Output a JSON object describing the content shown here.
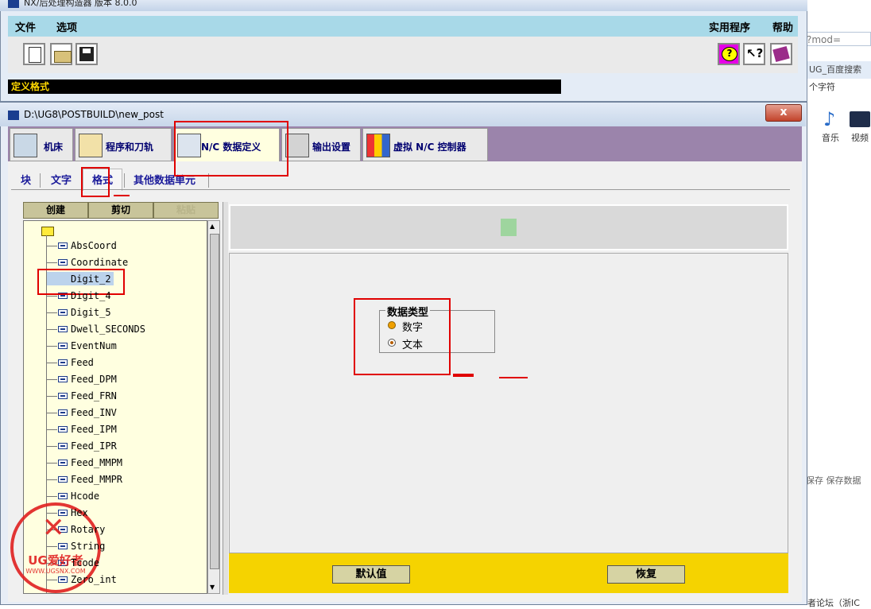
{
  "window1": {
    "title": "NX/后处理构造器 版本 8.0.0",
    "menu": {
      "file": "文件",
      "options": "选项",
      "utilities": "实用程序",
      "help": "帮助"
    },
    "status_text": "定义格式"
  },
  "window2": {
    "title": "D:\\UG8\\POSTBUILD\\new_post",
    "close_label": "x",
    "main_tabs": [
      "机床",
      "程序和刀轨",
      "N/C 数据定义",
      "输出设置",
      "虚拟 N/C 控制器"
    ],
    "sub_tabs": [
      "块",
      "文字",
      "格式",
      "其他数据单元"
    ],
    "tree_buttons": {
      "create": "创建",
      "cut": "剪切",
      "paste": "粘贴"
    },
    "tree_items": [
      "AbsCoord",
      "Coordinate",
      "Digit_2",
      "Digit_4",
      "Digit_5",
      "Dwell_SECONDS",
      "EventNum",
      "Feed",
      "Feed_DPM",
      "Feed_FRN",
      "Feed_INV",
      "Feed_IPM",
      "Feed_IPR",
      "Feed_MMPM",
      "Feed_MMPR",
      "Hcode",
      "Hex",
      "Rotary",
      "String",
      "Tcode",
      "Zero_int"
    ],
    "selected_item": "Digit_2",
    "data_type": {
      "title": "数据类型",
      "options": [
        "数字",
        "文本"
      ],
      "selected": "文本"
    },
    "buttons": {
      "default": "默认值",
      "restore": "恢复"
    }
  },
  "browser_bg": {
    "url_fragment": "?mod=",
    "tab": "UG_百度搜索",
    "text1": "个字符",
    "icons": [
      "音乐",
      "视频"
    ],
    "save_text": "保存 保存数据",
    "footer_text": "者论坛（浙IC"
  },
  "watermark": {
    "brand": "UG爱好者",
    "url": "WWW.UGSNX.COM"
  },
  "colors": {
    "menubar": "#a8d9e8",
    "tab_strip": "#9b84ab",
    "tree_bg": "#ffffe0",
    "bottom_bar": "#f5d300",
    "status_text": "#ffd800",
    "annotation": "#e00000"
  }
}
